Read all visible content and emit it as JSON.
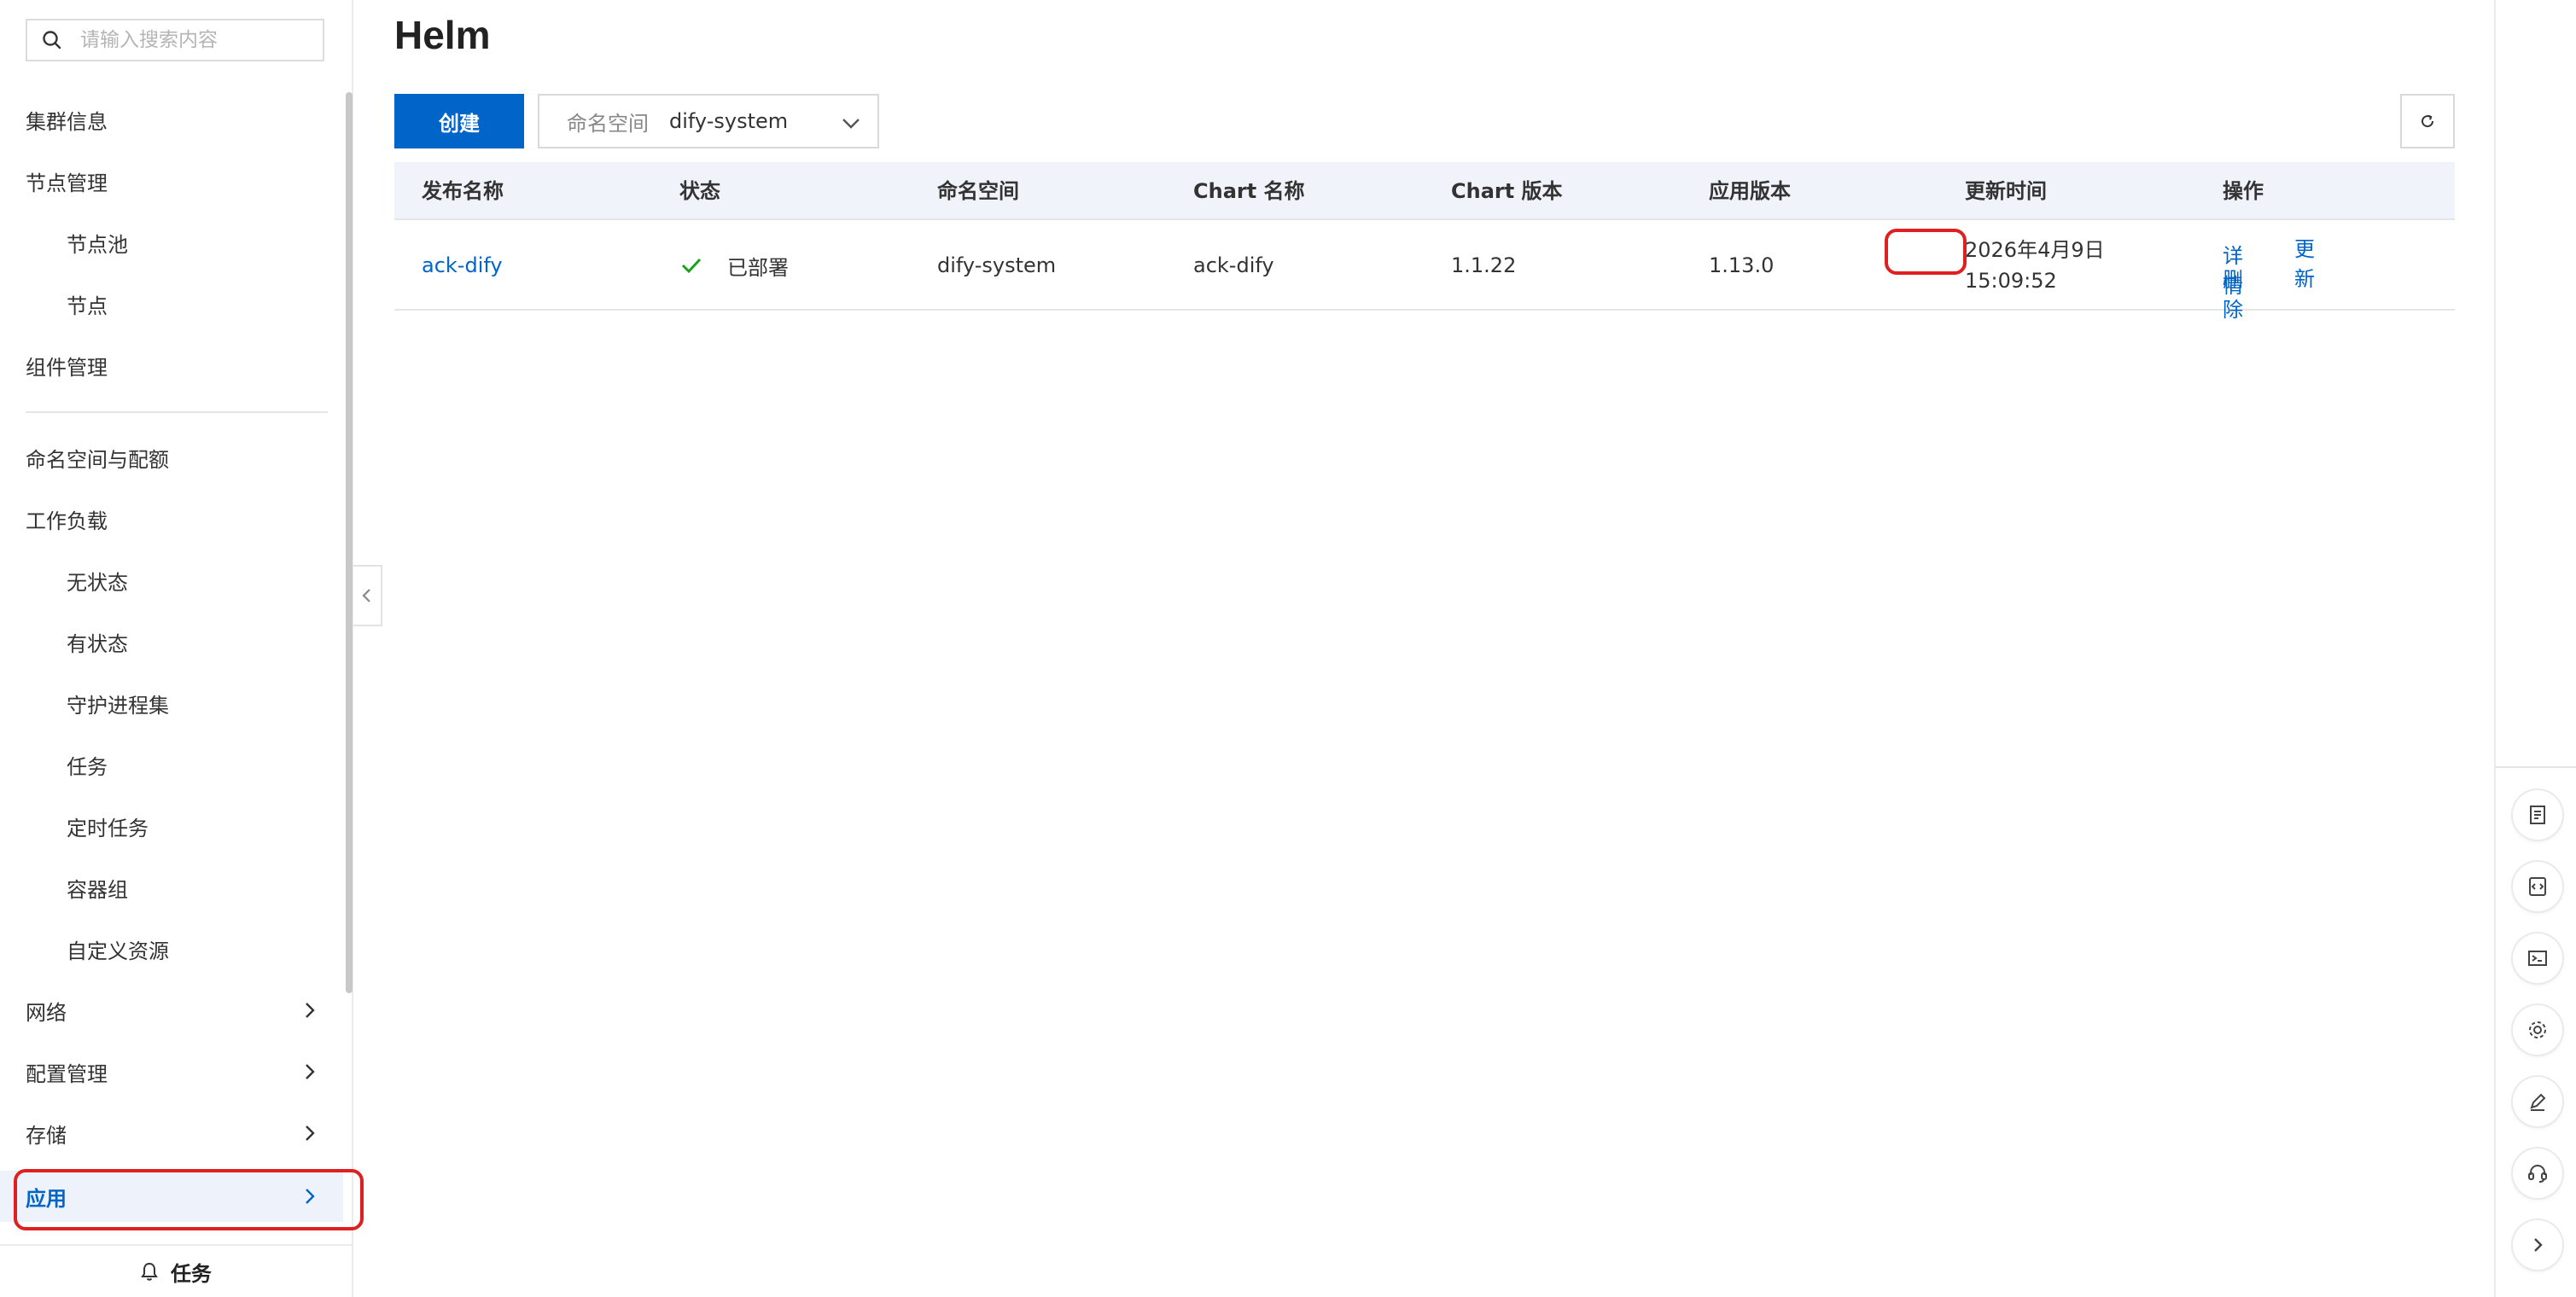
{
  "search": {
    "placeholder": "请输入搜索内容"
  },
  "sidebar": {
    "items": [
      {
        "label": "集群信息"
      },
      {
        "label": "节点管理"
      },
      {
        "label": "节点池"
      },
      {
        "label": "节点"
      },
      {
        "label": "组件管理"
      },
      {
        "label": "命名空间与配额"
      },
      {
        "label": "工作负载"
      },
      {
        "label": "无状态"
      },
      {
        "label": "有状态"
      },
      {
        "label": "守护进程集"
      },
      {
        "label": "任务"
      },
      {
        "label": "定时任务"
      },
      {
        "label": "容器组"
      },
      {
        "label": "自定义资源"
      },
      {
        "label": "网络"
      },
      {
        "label": "配置管理"
      },
      {
        "label": "存储"
      },
      {
        "label": "应用"
      }
    ],
    "active_item": "应用",
    "tasks_label": "任务"
  },
  "page": {
    "title": "Helm"
  },
  "toolbar": {
    "create_label": "创建",
    "namespace_label": "命名空间",
    "namespace_value": "dify-system"
  },
  "table": {
    "columns": [
      "发布名称",
      "状态",
      "命名空间",
      "Chart 名称",
      "Chart 版本",
      "应用版本",
      "更新时间",
      "操作"
    ],
    "rows": [
      {
        "release_name": "ack-dify",
        "status": "已部署",
        "namespace": "dify-system",
        "chart_name": "ack-dify",
        "chart_version": "1.1.22",
        "app_version": "1.13.0",
        "updated_date": "2026年4月9日",
        "updated_time": "15:09:52",
        "actions": {
          "detail": "详情",
          "delete": "删除",
          "update": "更新"
        }
      }
    ]
  },
  "rail": {
    "icons": [
      "document-icon",
      "code-icon",
      "terminal-icon",
      "gear-icon",
      "edit-icon",
      "headset-icon",
      "chevron-right-icon"
    ]
  },
  "colors": {
    "primary": "#0064c8",
    "success": "#1aa21a",
    "highlight": "#e02020",
    "header_bg": "#f0f4fa"
  }
}
